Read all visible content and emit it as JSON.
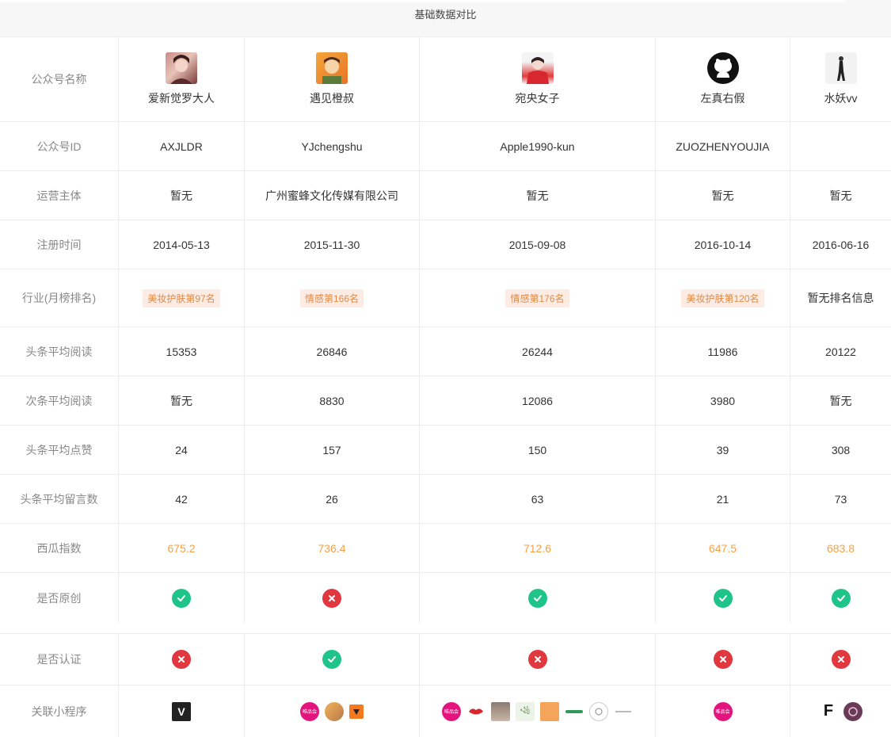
{
  "header": {
    "title": "基础数据对比"
  },
  "accounts": [
    {
      "name": "爱新觉罗大人",
      "id": "AXJLDR",
      "entity": "暂无",
      "reg_date": "2014-05-13",
      "industry": "美妆护肤第97名",
      "industry_badge": true,
      "headline_avg_read": "15353",
      "second_avg_read": "暂无",
      "headline_avg_like": "24",
      "headline_avg_comment": "42",
      "watermelon_index": "675.2",
      "is_original": true,
      "is_verified": false,
      "avatar_icon": "portrait-girl-avatar"
    },
    {
      "name": "遇见橙叔",
      "id": "YJchengshu",
      "entity": "广州蜜蜂文化传媒有限公司",
      "reg_date": "2015-11-30",
      "industry": "情感第166名",
      "industry_badge": true,
      "headline_avg_read": "26846",
      "second_avg_read": "8830",
      "headline_avg_like": "157",
      "headline_avg_comment": "26",
      "watermelon_index": "736.4",
      "is_original": false,
      "is_verified": true,
      "avatar_icon": "cartoon-man-avatar"
    },
    {
      "name": "宛央女子",
      "id": "Apple1990-kun",
      "entity": "暂无",
      "reg_date": "2015-09-08",
      "industry": "情感第176名",
      "industry_badge": true,
      "headline_avg_read": "26244",
      "second_avg_read": "12086",
      "headline_avg_like": "150",
      "headline_avg_comment": "63",
      "watermelon_index": "712.6",
      "is_original": true,
      "is_verified": false,
      "avatar_icon": "red-scarf-woman-avatar"
    },
    {
      "name": "左真右假",
      "id": "ZUOZHENYOUJIA",
      "entity": "暂无",
      "reg_date": "2016-10-14",
      "industry": "美妆护肤第120名",
      "industry_badge": true,
      "headline_avg_read": "11986",
      "second_avg_read": "3980",
      "headline_avg_like": "39",
      "headline_avg_comment": "21",
      "watermelon_index": "647.5",
      "is_original": true,
      "is_verified": false,
      "avatar_icon": "github-octocat-avatar"
    },
    {
      "name": "水妖vv",
      "id": "",
      "entity": "暂无",
      "reg_date": "2016-06-16",
      "industry": "暂无排名信息",
      "industry_badge": false,
      "headline_avg_read": "20122",
      "second_avg_read": "暂无",
      "headline_avg_like": "308",
      "headline_avg_comment": "73",
      "watermelon_index": "683.8",
      "is_original": true,
      "is_verified": false,
      "avatar_icon": "standing-figure-avatar"
    }
  ],
  "row_labels": {
    "name": "公众号名称",
    "id": "公众号ID",
    "entity": "运营主体",
    "reg_date": "注册时间",
    "industry": "行业(月榜排名)",
    "headline_avg_read": "头条平均阅读",
    "second_avg_read": "次条平均阅读",
    "headline_avg_like": "头条平均点赞",
    "headline_avg_comment": "头条平均留言数",
    "watermelon_index": "西瓜指数",
    "is_original": "是否原创",
    "is_verified": "是否认证",
    "mini_programs": "关联小程序"
  },
  "mini_programs": [
    [
      {
        "icon": "v-letter-app-icon",
        "text": "V"
      }
    ],
    [
      {
        "icon": "vip-pink-app-icon",
        "text": "唯品会"
      },
      {
        "icon": "orange-avatar-app-icon",
        "text": ""
      },
      {
        "icon": "orange-shield-app-icon",
        "text": ""
      }
    ],
    [
      {
        "icon": "vip-pink-app-icon",
        "text": "唯品会"
      },
      {
        "icon": "red-lips-app-icon",
        "text": ""
      },
      {
        "icon": "woman-photo-app-icon",
        "text": ""
      },
      {
        "icon": "green-text-app-icon",
        "text": ""
      },
      {
        "icon": "orange-square-app-icon",
        "text": ""
      },
      {
        "icon": "green-logo-app-icon",
        "text": ""
      },
      {
        "icon": "seal-app-icon",
        "text": ""
      },
      {
        "icon": "grey-text-app-icon",
        "text": ""
      }
    ],
    [
      {
        "icon": "vip-pink-app-icon",
        "text": "唯品会"
      }
    ],
    [
      {
        "icon": "f-letter-app-icon",
        "text": "F"
      },
      {
        "icon": "purple-emblem-app-icon",
        "text": ""
      }
    ]
  ],
  "colors": {
    "accent_orange": "#f5a146",
    "badge_bg": "#fdece3",
    "badge_text": "#e08a48",
    "check_green": "#1fc48a",
    "cross_red": "#e0383e"
  }
}
